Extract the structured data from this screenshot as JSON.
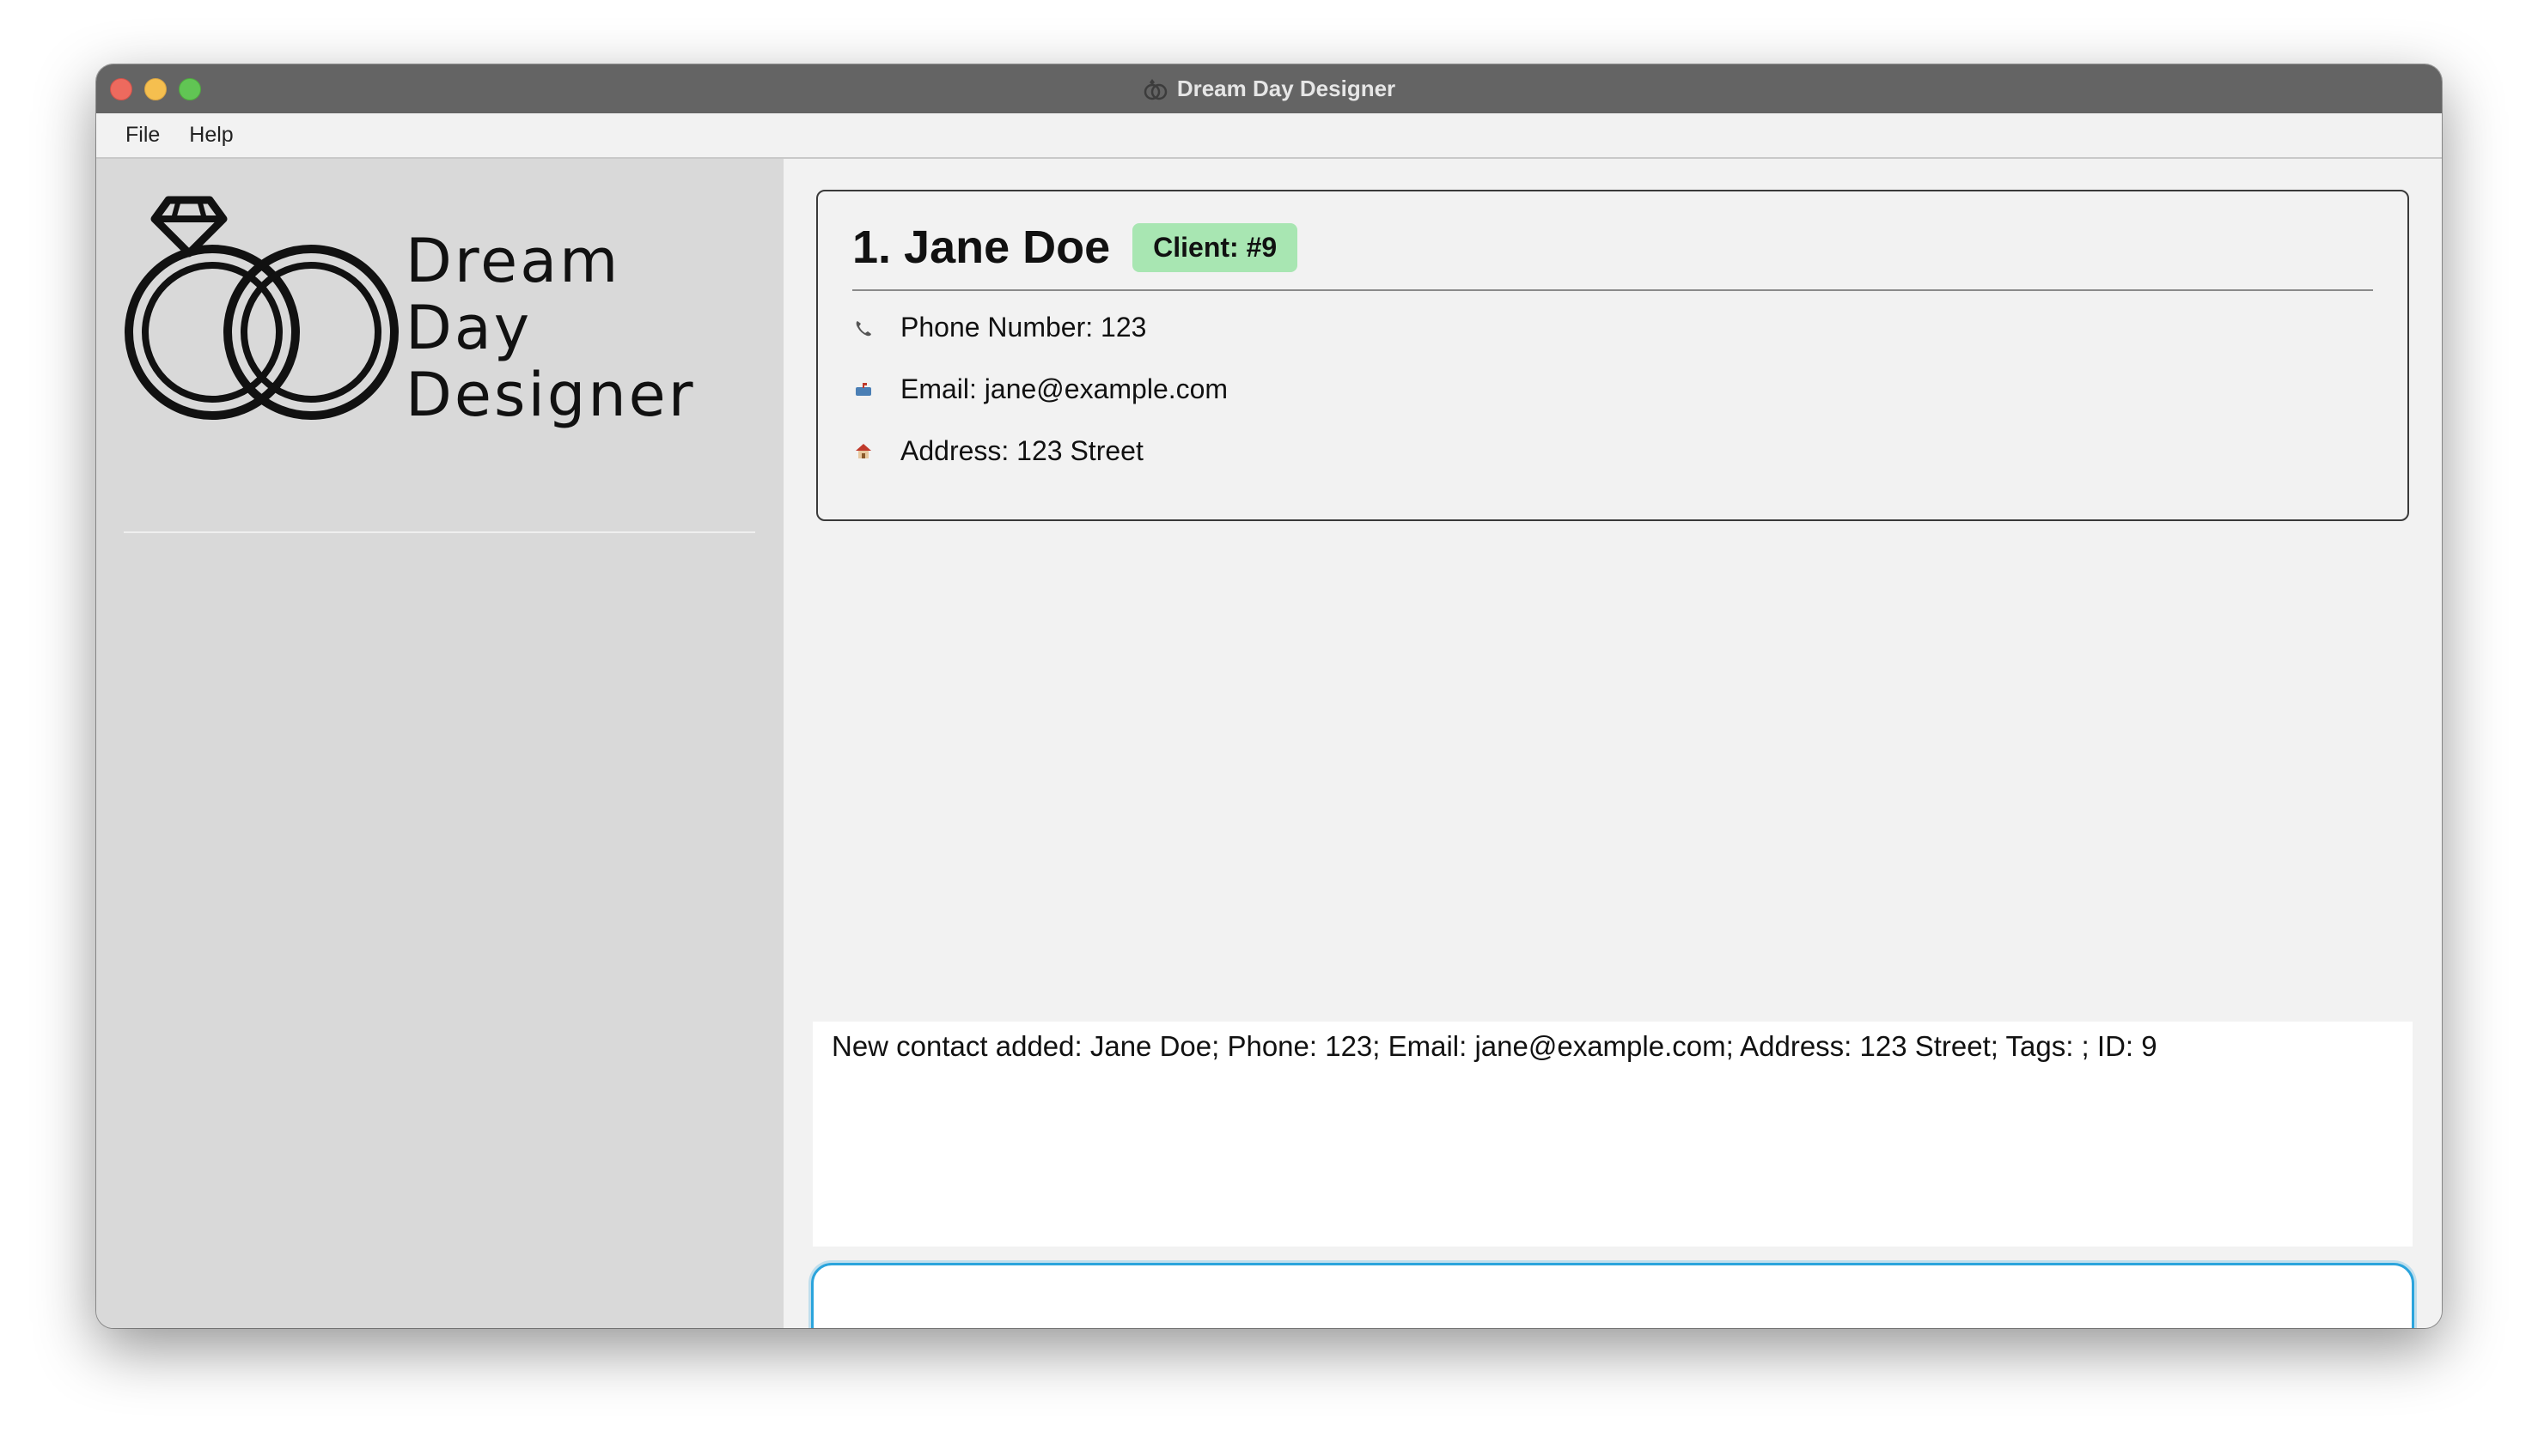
{
  "window": {
    "title": "Dream Day Designer"
  },
  "menu": {
    "file": "File",
    "help": "Help"
  },
  "logo": {
    "line1": "Dream",
    "line2": "Day",
    "line3": "Designer"
  },
  "client": {
    "name": "1. Jane Doe",
    "badge": "Client: #9",
    "phone": "Phone Number: 123",
    "email": "Email: jane@example.com",
    "address": "Address: 123 Street"
  },
  "result_message": "New contact added: Jane Doe; Phone: 123; Email: jane@example.com; Address: 123 Street; Tags: ; ID: 9",
  "command": {
    "value": ""
  },
  "colors": {
    "badge": "#a8e6b2",
    "focus": "#2ba4dc",
    "titlebar": "#646464"
  }
}
